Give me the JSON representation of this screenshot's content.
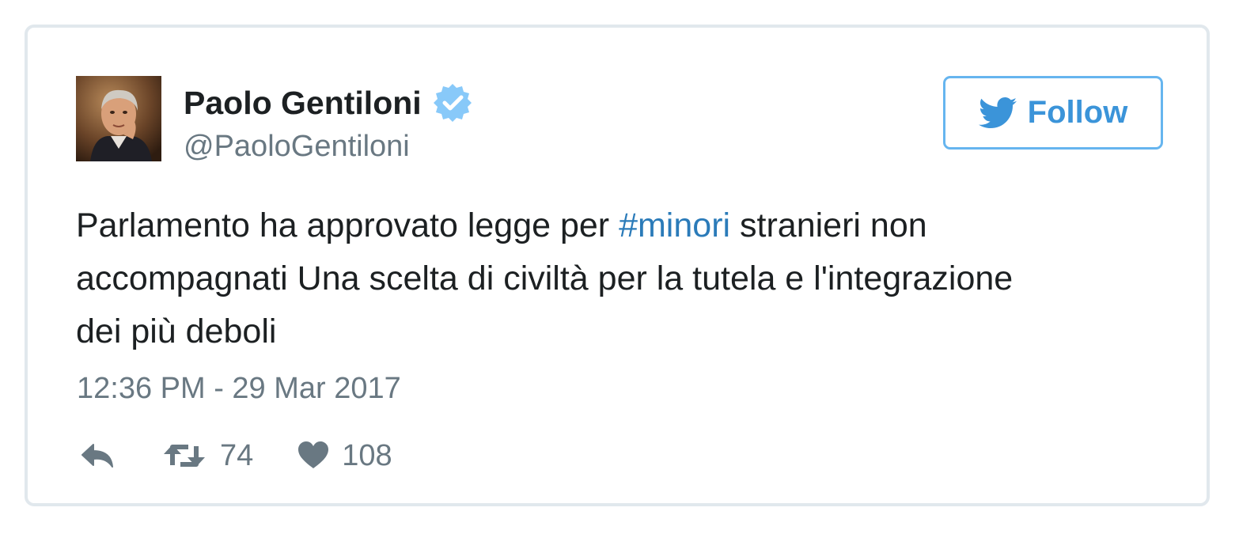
{
  "tweet": {
    "author": {
      "display_name": "Paolo Gentiloni",
      "handle": "@PaoloGentiloni",
      "verified": true
    },
    "follow_label": "Follow",
    "text_lines": [
      {
        "before": "Parlamento ha approvato legge per ",
        "hashtag": "#minori",
        "after": " stranieri non"
      },
      {
        "text": "accompagnati Una scelta di civiltà per la tutela e l'integrazione"
      },
      {
        "text": "dei più deboli"
      }
    ],
    "timestamp": "12:36 PM - 29 Mar 2017",
    "stats": {
      "retweets": "74",
      "likes": "108"
    }
  },
  "icons": {
    "reply": "reply-icon",
    "retweet": "retweet-icon",
    "like": "heart-icon",
    "verified": "verified-badge-icon",
    "follow": "twitter-bird-icon"
  },
  "colors": {
    "link": "#2b7bb9",
    "follow_accent": "#3b94d9",
    "muted": "#697882",
    "text": "#1c2022",
    "card_border": "#e1e8ed"
  }
}
